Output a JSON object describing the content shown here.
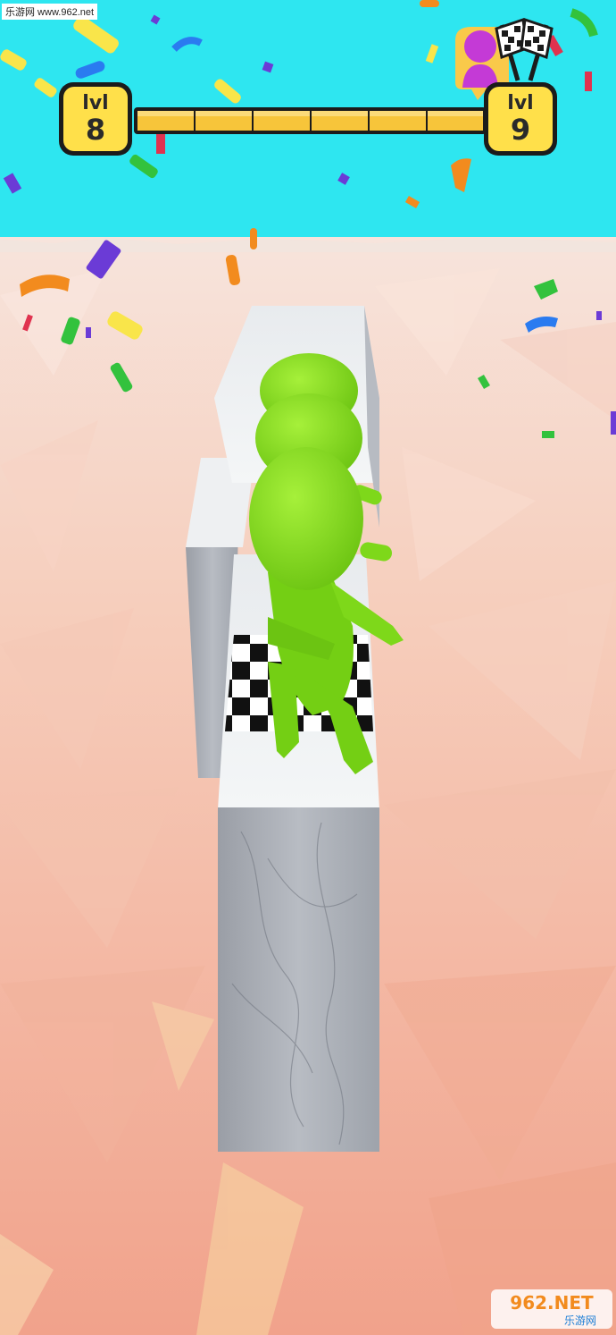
{
  "watermark_top": {
    "text": "乐游网 www.962.net"
  },
  "hud": {
    "current_level": {
      "word": "lvl",
      "number": "8"
    },
    "next_level": {
      "word": "lvl",
      "number": "9"
    },
    "progress": 1.0,
    "icons": [
      "finish-flags-icon",
      "opponent-avatar-icon"
    ]
  },
  "watermark_bottom": {
    "main": "962.NET",
    "sub": "乐游网"
  },
  "colors": {
    "sky": "#2ee6f0",
    "ground": "#f3b9a2",
    "player_green": "#86e21a",
    "level_badge_yellow": "#ffe04a",
    "progress_bar": "#f7c53a",
    "opponent_pink": "#c43ad6",
    "marble": "#e8ecef"
  }
}
